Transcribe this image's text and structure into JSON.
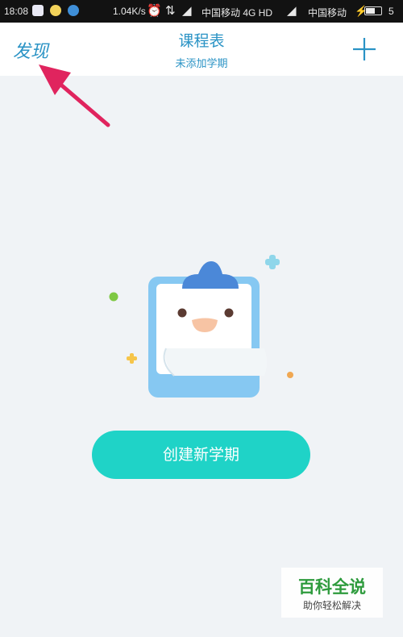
{
  "status_bar": {
    "time": "18:08",
    "net_speed": "1.04K/s",
    "carrier_1": "中国移动 4G HD",
    "carrier_2": "中国移动",
    "battery_num": "5",
    "battery_level": 0.6
  },
  "header": {
    "discover_label": "发现",
    "title": "课程表",
    "subtitle": "未添加学期",
    "add_icon": "plus-icon"
  },
  "main": {
    "create_button_label": "创建新学期"
  },
  "watermark": {
    "line1": "百科全说",
    "line2": "助你轻松解决"
  },
  "colors": {
    "accent": "#2a93c5",
    "button": "#1fd3c7",
    "arrow": "#e0245e",
    "background": "#f0f3f6"
  }
}
